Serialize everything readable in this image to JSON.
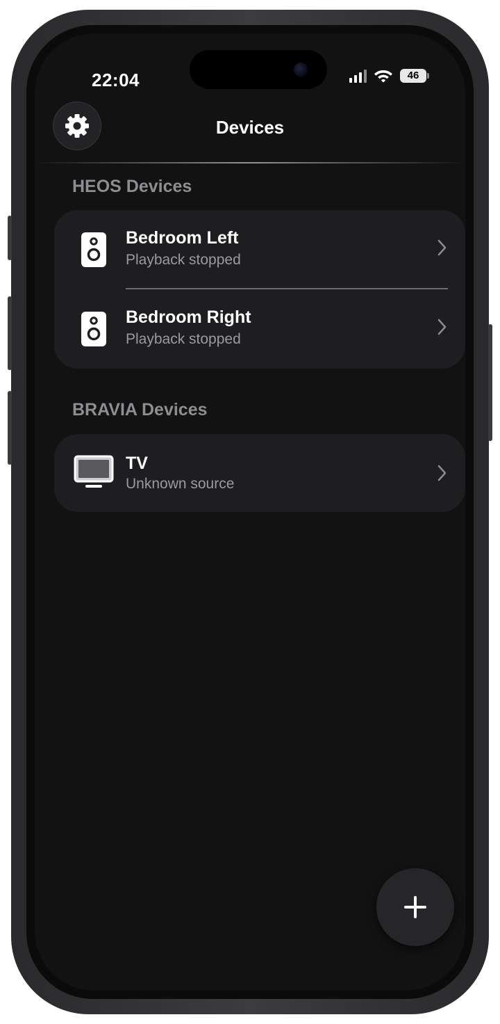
{
  "status_bar": {
    "time": "22:04",
    "battery": "46",
    "icons": [
      "cellular-signal-icon",
      "wifi-icon",
      "battery-icon"
    ]
  },
  "nav": {
    "title": "Devices",
    "settings_icon": "gear-icon"
  },
  "sections": [
    {
      "header": "HEOS Devices",
      "devices": [
        {
          "name": "Bedroom Left",
          "status": "Playback stopped",
          "icon": "speaker-icon"
        },
        {
          "name": "Bedroom Right",
          "status": "Playback stopped",
          "icon": "speaker-icon"
        }
      ]
    },
    {
      "header": "BRAVIA Devices",
      "devices": [
        {
          "name": "TV",
          "status": "Unknown source",
          "icon": "tv-icon"
        }
      ]
    }
  ],
  "fab": {
    "icon": "plus-icon"
  },
  "colors": {
    "background": "#121212",
    "card": "#1e1e20",
    "primary_text": "#ffffff",
    "secondary_text": "#9a9a9f",
    "section_header": "#8d8d92"
  }
}
